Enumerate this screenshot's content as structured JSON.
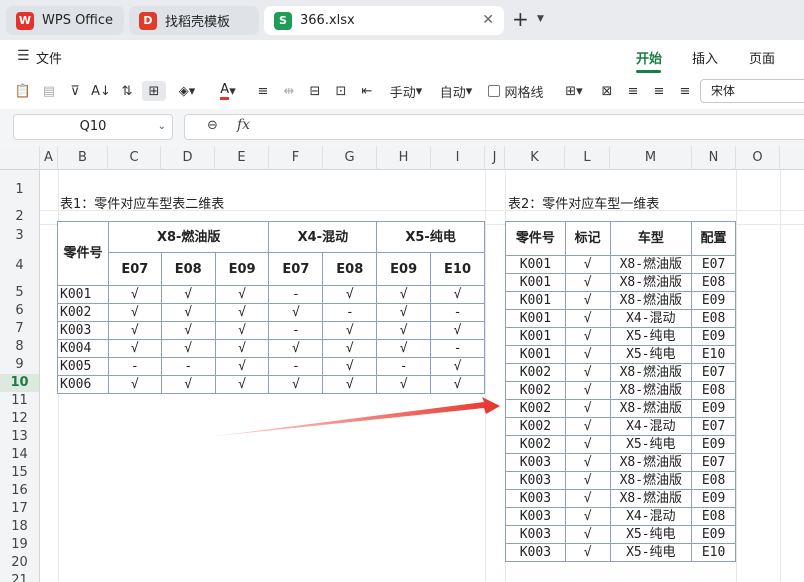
{
  "tabs": [
    {
      "label": "WPS Office",
      "logo": "W"
    },
    {
      "label": "找稻壳模板",
      "logo": "D"
    },
    {
      "label": "366.xlsx",
      "logo": "S"
    }
  ],
  "menu": {
    "file": "文件",
    "tabs": [
      "开始",
      "插入",
      "页面"
    ]
  },
  "toolbar": {
    "manual": "手动",
    "auto": "自动",
    "gridlines": "网格线",
    "font": "宋体"
  },
  "formula_bar": {
    "cell_ref": "Q10",
    "fx": "fx",
    "value": ""
  },
  "columns": [
    "A",
    "B",
    "C",
    "D",
    "E",
    "F",
    "G",
    "H",
    "I",
    "J",
    "K",
    "L",
    "M",
    "N",
    "O"
  ],
  "rows": [
    "1",
    "2",
    "3",
    "4",
    "5",
    "6",
    "7",
    "8",
    "9",
    "10",
    "11",
    "12",
    "13",
    "14",
    "15",
    "16",
    "17",
    "18",
    "19",
    "20",
    "21"
  ],
  "table1": {
    "caption": "表1：零件对应车型表二维表",
    "corner": "零件号",
    "groups": [
      "X8-燃油版",
      "X4-混动",
      "X5-纯电"
    ],
    "configs": [
      "E07",
      "E08",
      "E09",
      "E07",
      "E08",
      "E09",
      "E10"
    ],
    "rows": [
      {
        "part": "K001",
        "marks": [
          "√",
          "√",
          "√",
          "-",
          "√",
          "√",
          "√"
        ]
      },
      {
        "part": "K002",
        "marks": [
          "√",
          "√",
          "√",
          "√",
          "-",
          "√",
          "-"
        ]
      },
      {
        "part": "K003",
        "marks": [
          "√",
          "√",
          "√",
          "-",
          "√",
          "√",
          "√"
        ]
      },
      {
        "part": "K004",
        "marks": [
          "√",
          "√",
          "√",
          "√",
          "√",
          "√",
          "-"
        ]
      },
      {
        "part": "K005",
        "marks": [
          "-",
          "-",
          "√",
          "-",
          "√",
          "-",
          "√"
        ]
      },
      {
        "part": "K006",
        "marks": [
          "√",
          "√",
          "√",
          "√",
          "√",
          "√",
          "√"
        ]
      }
    ]
  },
  "table2": {
    "caption": "表2：零件对应车型一维表",
    "headers": [
      "零件号",
      "标记",
      "车型",
      "配置"
    ],
    "rows": [
      [
        "K001",
        "√",
        "X8-燃油版",
        "E07"
      ],
      [
        "K001",
        "√",
        "X8-燃油版",
        "E08"
      ],
      [
        "K001",
        "√",
        "X8-燃油版",
        "E09"
      ],
      [
        "K001",
        "√",
        "X4-混动",
        "E08"
      ],
      [
        "K001",
        "√",
        "X5-纯电",
        "E09"
      ],
      [
        "K001",
        "√",
        "X5-纯电",
        "E10"
      ],
      [
        "K002",
        "√",
        "X8-燃油版",
        "E07"
      ],
      [
        "K002",
        "√",
        "X8-燃油版",
        "E08"
      ],
      [
        "K002",
        "√",
        "X8-燃油版",
        "E09"
      ],
      [
        "K002",
        "√",
        "X4-混动",
        "E07"
      ],
      [
        "K002",
        "√",
        "X5-纯电",
        "E09"
      ],
      [
        "K003",
        "√",
        "X8-燃油版",
        "E07"
      ],
      [
        "K003",
        "√",
        "X8-燃油版",
        "E08"
      ],
      [
        "K003",
        "√",
        "X8-燃油版",
        "E09"
      ],
      [
        "K003",
        "√",
        "X4-混动",
        "E08"
      ],
      [
        "K003",
        "√",
        "X5-纯电",
        "E09"
      ],
      [
        "K003",
        "√",
        "X5-纯电",
        "E10"
      ]
    ]
  },
  "colors": {
    "accent": "#1c7d44",
    "arrow": "#e8332a",
    "table_border": "#8a9ec9"
  }
}
